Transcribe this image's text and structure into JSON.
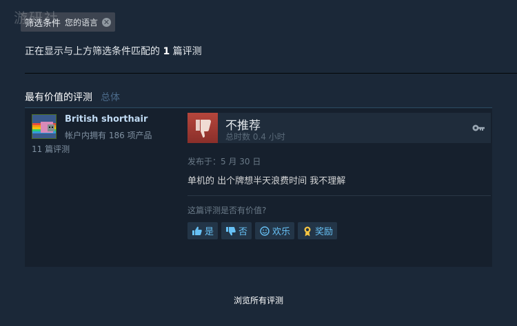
{
  "filter": {
    "label": "筛选条件",
    "chip": "您的语言",
    "close_glyph": "✕",
    "summary_prefix": "正在显示与上方筛选条件匹配的",
    "summary_count": "1",
    "summary_suffix": "篇评测"
  },
  "watermark": "游研社",
  "tabs": {
    "most_helpful": "最有价值的评测",
    "overall": "总体"
  },
  "review": {
    "author_name": "British shorthair",
    "products": "帐户内拥有 186 项产品",
    "reviews": "11 篇评测",
    "verdict": "不推荐",
    "hours": "总时数 0.4 小时",
    "posted": "发布于：5 月 30 日",
    "text": "单机的 出个牌想半天浪费时间 我不理解",
    "helpful_question": "这篇评测是否有价值?",
    "votes": {
      "yes": "是",
      "no": "否",
      "funny": "欢乐",
      "award": "奖励"
    }
  },
  "browse_all": "浏览所有评测",
  "colors": {
    "background": "#1b2838",
    "review_bg": "#16202d",
    "accent_blue": "#67c1f5",
    "thumb_down_red": "#a33a32"
  }
}
